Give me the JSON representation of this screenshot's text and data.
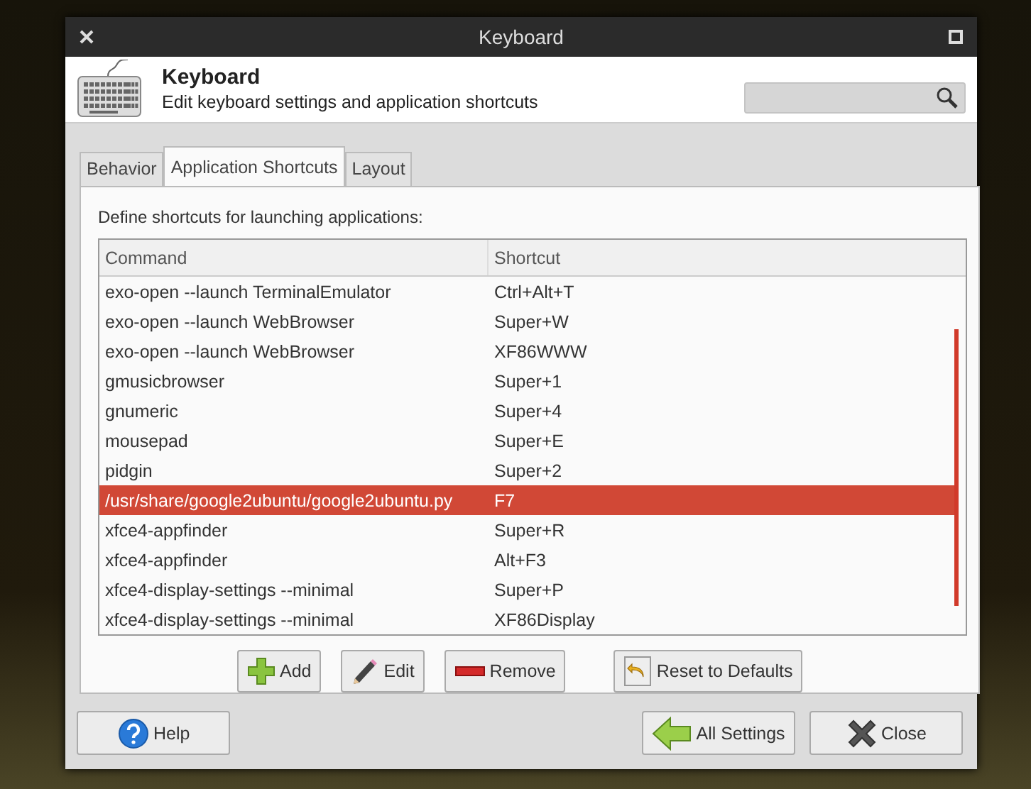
{
  "window": {
    "title": "Keyboard"
  },
  "header": {
    "title": "Keyboard",
    "subtitle": "Edit keyboard settings and application shortcuts"
  },
  "tabs": [
    {
      "label": "Behavior",
      "selected": false
    },
    {
      "label": "Application Shortcuts",
      "selected": true
    },
    {
      "label": "Layout",
      "selected": false
    }
  ],
  "description": "Define shortcuts for launching applications:",
  "table": {
    "columns": [
      "Command",
      "Shortcut"
    ],
    "rows": [
      {
        "command": "exo-open --launch TerminalEmulator",
        "shortcut": "Ctrl+Alt+T",
        "selected": false
      },
      {
        "command": "exo-open --launch WebBrowser",
        "shortcut": "Super+W",
        "selected": false
      },
      {
        "command": "exo-open --launch WebBrowser",
        "shortcut": "XF86WWW",
        "selected": false
      },
      {
        "command": "gmusicbrowser",
        "shortcut": "Super+1",
        "selected": false
      },
      {
        "command": "gnumeric",
        "shortcut": "Super+4",
        "selected": false
      },
      {
        "command": "mousepad",
        "shortcut": "Super+E",
        "selected": false
      },
      {
        "command": "pidgin",
        "shortcut": "Super+2",
        "selected": false
      },
      {
        "command": "/usr/share/google2ubuntu/google2ubuntu.py",
        "shortcut": "F7",
        "selected": true
      },
      {
        "command": "xfce4-appfinder",
        "shortcut": "Super+R",
        "selected": false
      },
      {
        "command": "xfce4-appfinder",
        "shortcut": "Alt+F3",
        "selected": false
      },
      {
        "command": "xfce4-display-settings --minimal",
        "shortcut": "Super+P",
        "selected": false
      },
      {
        "command": "xfce4-display-settings --minimal",
        "shortcut": "XF86Display",
        "selected": false
      }
    ]
  },
  "actions": [
    {
      "kind": "add",
      "label": "Add"
    },
    {
      "kind": "edit",
      "label": "Edit"
    },
    {
      "kind": "remove",
      "label": "Remove"
    },
    {
      "kind": "reset",
      "label": "Reset to Defaults"
    }
  ],
  "footer": [
    {
      "kind": "help",
      "label": "Help"
    },
    {
      "kind": "all-settings",
      "label": "All Settings"
    },
    {
      "kind": "close",
      "label": "Close"
    }
  ]
}
